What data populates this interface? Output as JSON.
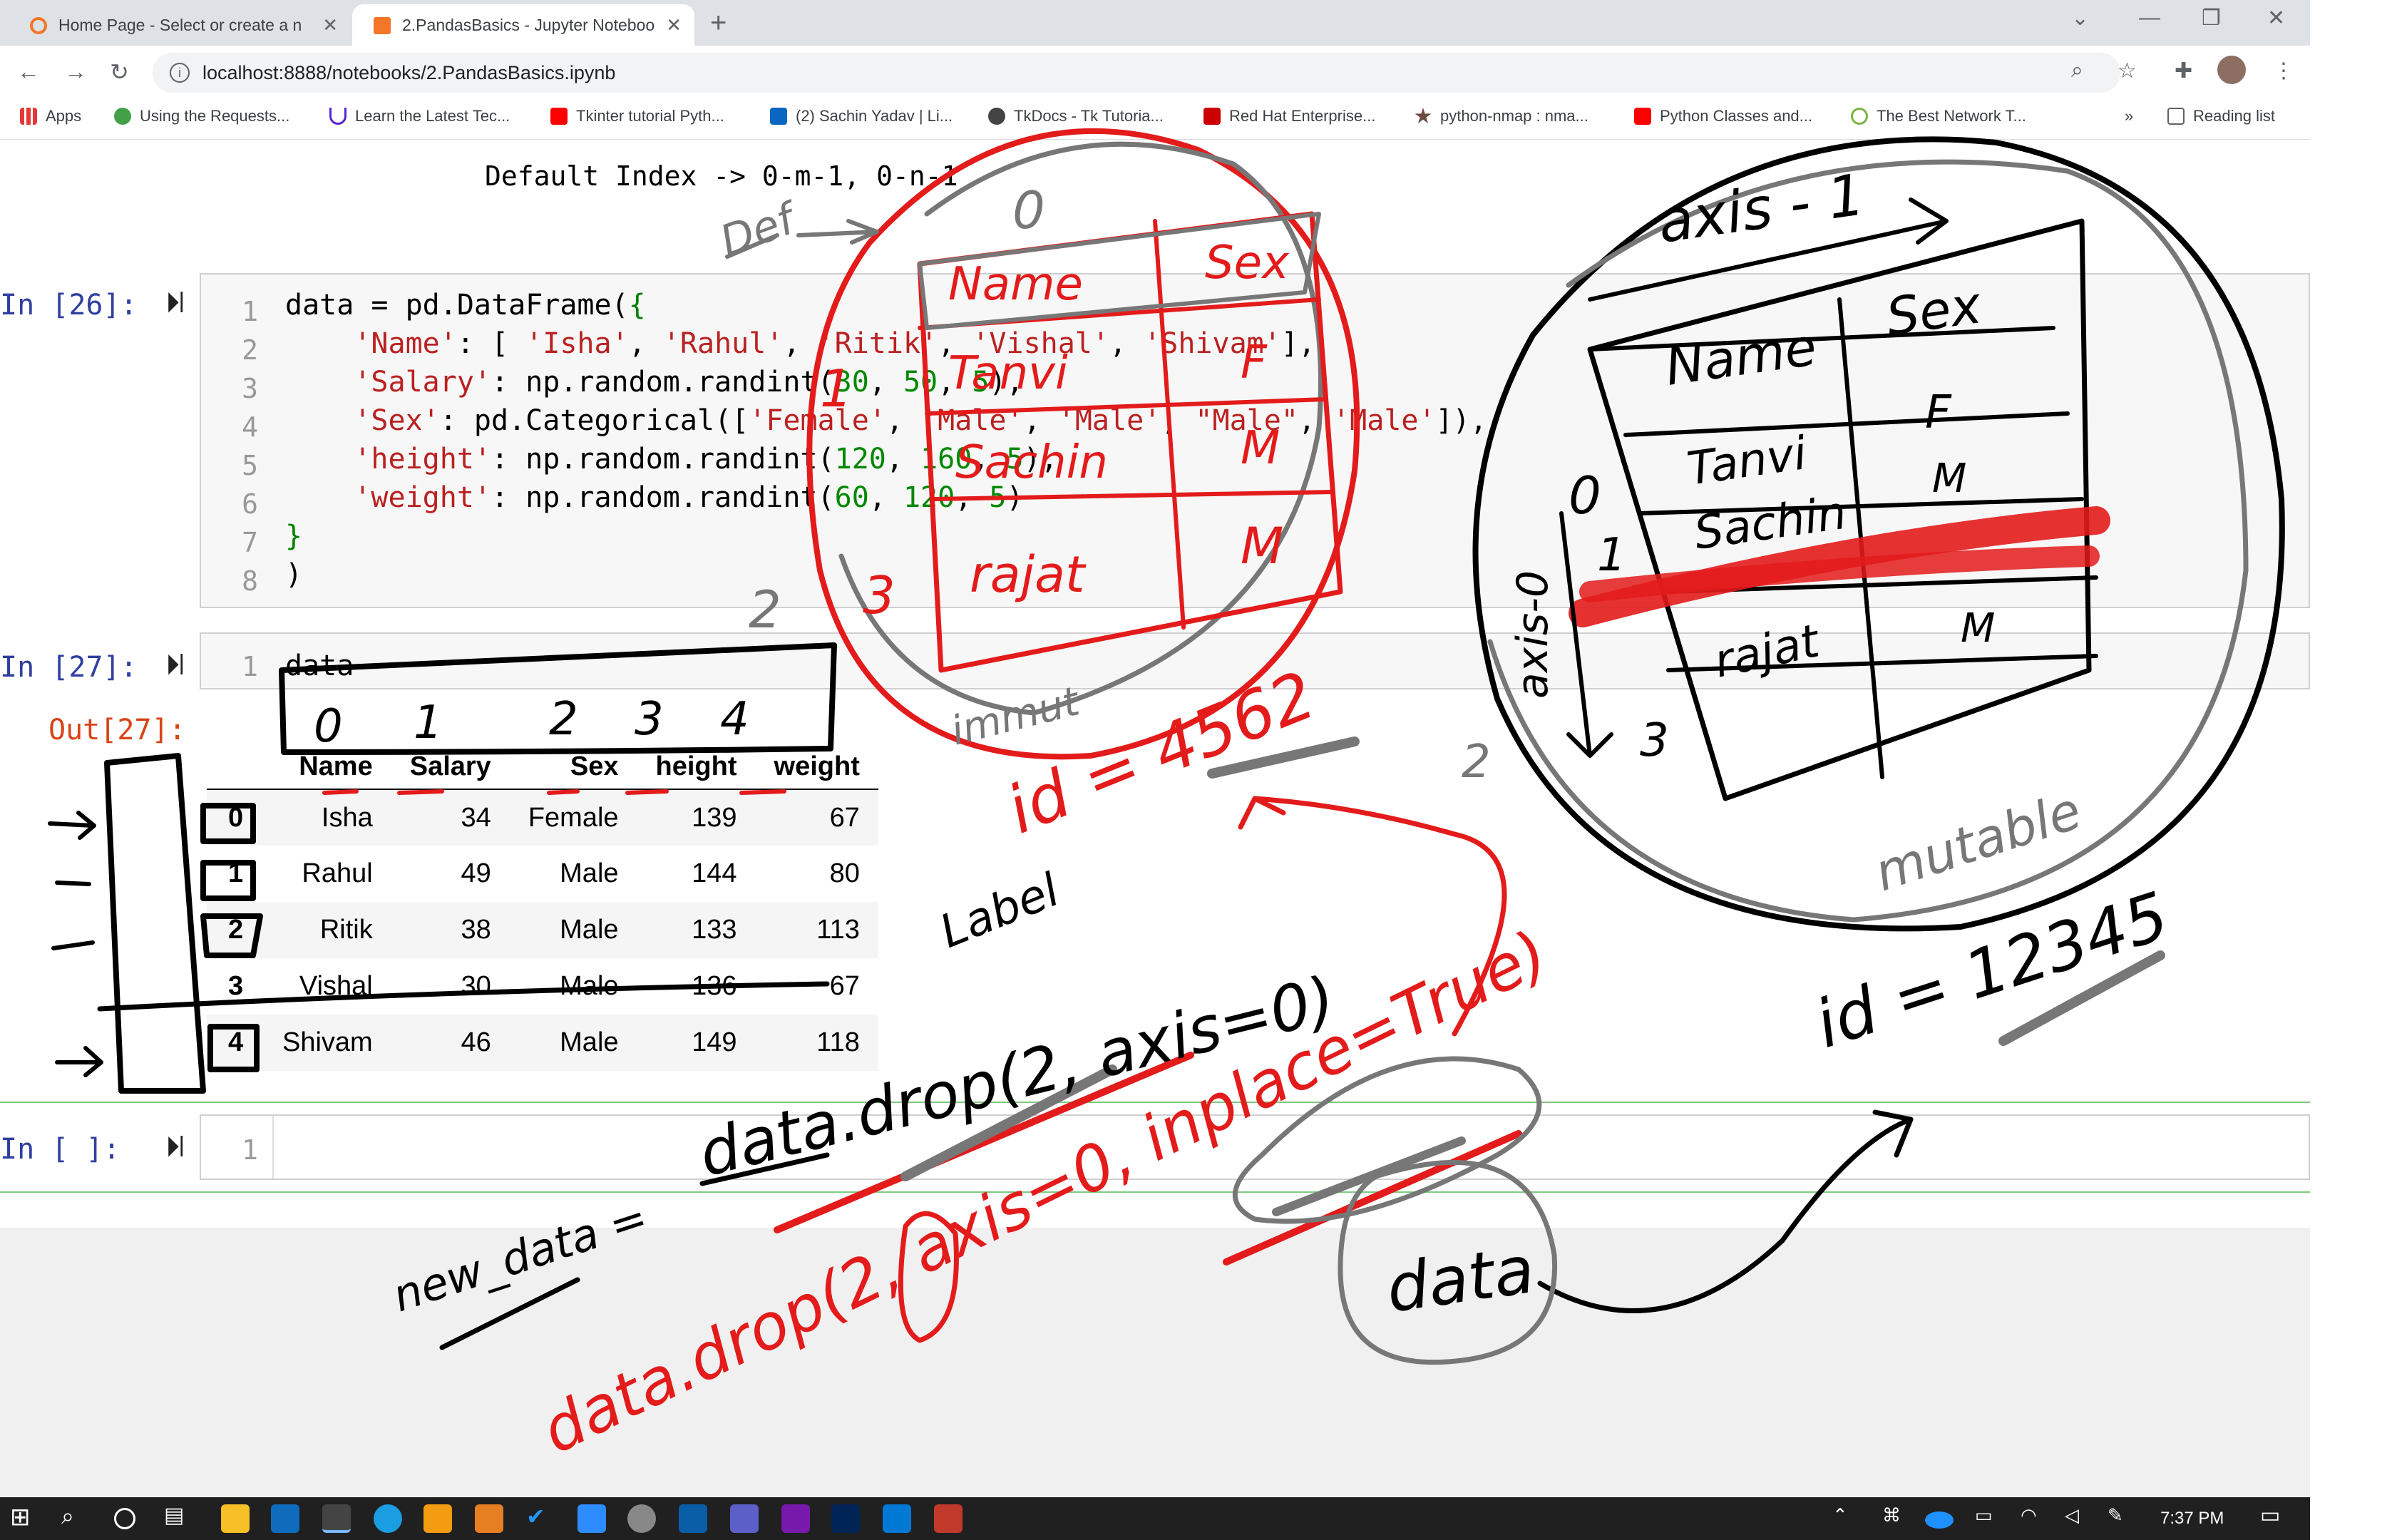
{
  "browser": {
    "tabs": [
      {
        "title": "Home Page - Select or create a n",
        "active": false
      },
      {
        "title": "2.PandasBasics - Jupyter Noteboo",
        "active": true
      }
    ],
    "url": "localhost:8888/notebooks/2.PandasBasics.ipynb",
    "bookmarks": [
      "Apps",
      "Using the Requests...",
      "Learn the Latest Tec...",
      "Tkinter tutorial Pyth...",
      "(2) Sachin Yadav | Li...",
      "TkDocs - Tk Tutoria...",
      "Red Hat Enterprise...",
      "python-nmap : nma...",
      "Python Classes and...",
      "The Best Network T...",
      "»",
      "Reading list"
    ]
  },
  "notebook": {
    "markdown_line": "Default Index -> 0-m-1, 0-n-1",
    "cell1": {
      "prompt": "In [26]:",
      "line_numbers": [
        "1",
        "2",
        "3",
        "4",
        "5",
        "6",
        "7",
        "8"
      ]
    },
    "cell2": {
      "prompt": "In [27]:",
      "line_number": "1",
      "code": "data",
      "out_prompt": "Out[27]:"
    },
    "cell3": {
      "prompt": "In [ ]:",
      "line_number": "1"
    }
  },
  "dataframe": {
    "columns": [
      "Name",
      "Salary",
      "Sex",
      "height",
      "weight"
    ],
    "rows": [
      {
        "index": "0",
        "values": [
          "Isha",
          "34",
          "Female",
          "139",
          "67"
        ]
      },
      {
        "index": "1",
        "values": [
          "Rahul",
          "49",
          "Male",
          "144",
          "80"
        ]
      },
      {
        "index": "2",
        "values": [
          "Ritik",
          "38",
          "Male",
          "133",
          "113"
        ]
      },
      {
        "index": "3",
        "values": [
          "Vishal",
          "30",
          "Male",
          "136",
          "67"
        ]
      },
      {
        "index": "4",
        "values": [
          "Shivam",
          "46",
          "Male",
          "149",
          "118"
        ]
      }
    ]
  },
  "annotations": {
    "axis1": "axis - 1",
    "axis0": "axis-0",
    "immutable": "immut",
    "mutable": "mutable",
    "id_left": "id = 4562",
    "id_right": "id = 12345",
    "label": "Label",
    "drop_call": "data.drop(2, axis=0)",
    "new_data": "new_data =",
    "drop_inplace": "data.drop(2, axis=0, inplace=True)",
    "data_word": "data",
    "def_label": "Def",
    "left_cols": [
      "0",
      "1",
      "2",
      "3",
      "4"
    ],
    "left_table": {
      "h1": "Name",
      "h2": "Sex",
      "r1": [
        "Tanvi",
        "F"
      ],
      "r2": [
        "Sachin",
        "M"
      ],
      "r3": [
        "rajat",
        "M"
      ],
      "idx": [
        "0",
        "1",
        "2",
        "3"
      ]
    },
    "right_table": {
      "h1": "Name",
      "h2": "Sex",
      "r1": [
        "Tanvi",
        "F"
      ],
      "r2": [
        "Sachin",
        "M"
      ],
      "r3": [
        "rajat",
        "M"
      ],
      "idx": [
        "0",
        "1",
        "2",
        "3"
      ]
    }
  },
  "taskbar": {
    "time": "7:37 PM"
  }
}
